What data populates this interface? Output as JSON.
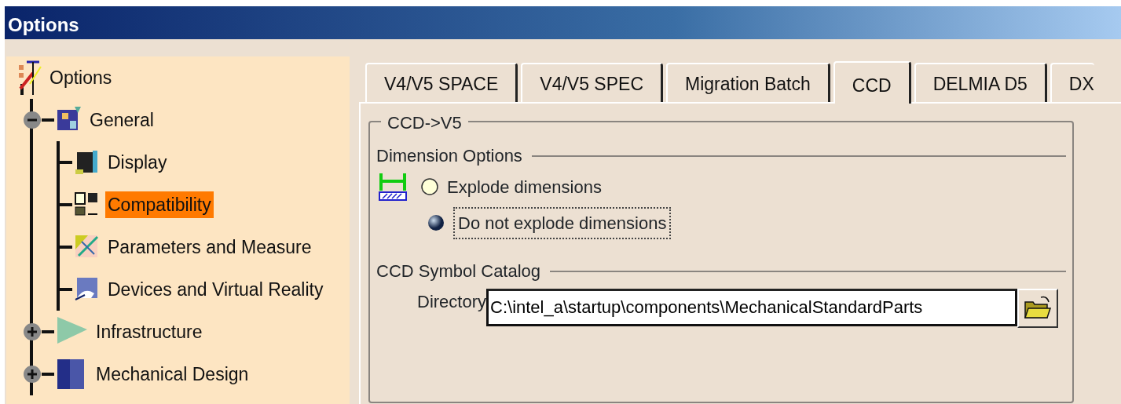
{
  "window": {
    "title": "Options"
  },
  "tree": {
    "label": "Options",
    "children": [
      {
        "label": "General",
        "expanded": true,
        "selected": false,
        "children": [
          {
            "label": "Display",
            "selected": false
          },
          {
            "label": "Compatibility",
            "selected": true
          },
          {
            "label": "Parameters and Measure",
            "selected": false
          },
          {
            "label": "Devices and Virtual Reality",
            "selected": false
          }
        ]
      },
      {
        "label": "Infrastructure",
        "expanded": false,
        "selected": false
      },
      {
        "label": "Mechanical Design",
        "expanded": false,
        "selected": false
      }
    ]
  },
  "tabs": [
    {
      "label": "V4/V5 SPACE",
      "selected": false
    },
    {
      "label": "V4/V5 SPEC",
      "selected": false
    },
    {
      "label": "Migration Batch",
      "selected": false
    },
    {
      "label": "CCD",
      "selected": true
    },
    {
      "label": "DELMIA D5",
      "selected": false
    },
    {
      "label": "DX",
      "selected": false
    }
  ],
  "group": {
    "title": "CCD->V5",
    "dimension_options": {
      "title": "Dimension Options",
      "options": [
        {
          "label": "Explode dimensions",
          "selected": false
        },
        {
          "label": "Do not explode dimensions",
          "selected": true
        }
      ]
    },
    "symbol_catalog": {
      "title": "CCD Symbol Catalog",
      "directory": {
        "label": "Directory",
        "value": "C:\\intel_a\\startup\\components\\MechanicalStandardParts"
      }
    }
  }
}
